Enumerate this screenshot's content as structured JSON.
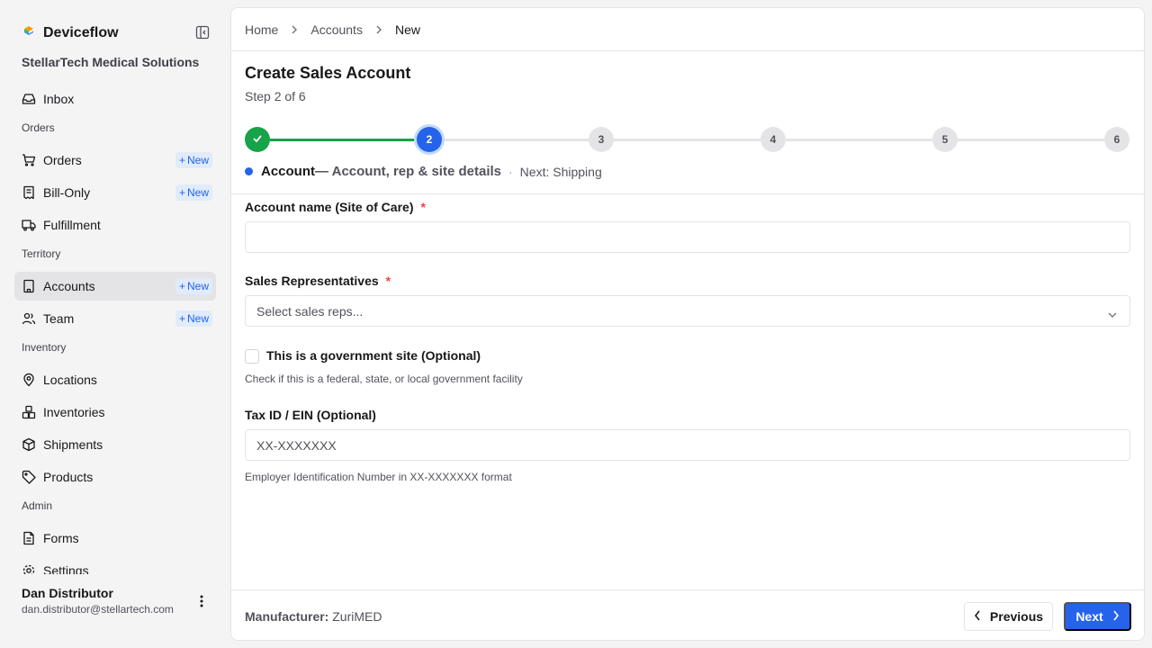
{
  "app": {
    "name": "Deviceflow",
    "org": "StellarTech Medical Solutions"
  },
  "sidebar": {
    "new_label": "New",
    "inbox": "Inbox",
    "sections": {
      "orders": "Orders",
      "territory": "Territory",
      "inventory": "Inventory",
      "admin": "Admin"
    },
    "items": {
      "orders": "Orders",
      "bill_only": "Bill-Only",
      "fulfillment": "Fulfillment",
      "accounts": "Accounts",
      "team": "Team",
      "locations": "Locations",
      "inventories": "Inventories",
      "shipments": "Shipments",
      "products": "Products",
      "forms": "Forms",
      "settings": "Settings"
    },
    "active": "accounts"
  },
  "user": {
    "name": "Dan Distributor",
    "email": "dan.distributor@stellartech.com"
  },
  "breadcrumb": {
    "home": "Home",
    "accounts": "Accounts",
    "current": "New"
  },
  "page": {
    "title": "Create Sales Account",
    "step_text": "Step 2 of 6"
  },
  "stepper": {
    "current_step": 2,
    "total_steps": 6,
    "labels": [
      "2",
      "3",
      "4",
      "5",
      "6"
    ],
    "current_name": "Account",
    "current_desc": "— Account, rep & site details",
    "separator": "·",
    "next": "Next: Shipping"
  },
  "form": {
    "account_name": {
      "label": "Account name (Site of Care)",
      "required": "*",
      "value": ""
    },
    "sales_reps": {
      "label": "Sales Representatives",
      "required": "*",
      "placeholder": "Select sales reps..."
    },
    "gov_site": {
      "label": "This is a government site (Optional)",
      "help": "Check if this is a federal, state, or local government facility",
      "checked": false
    },
    "tax_id": {
      "label": "Tax ID / EIN (Optional)",
      "placeholder": "XX-XXXXXXX",
      "help": "Employer Identification Number in XX-XXXXXXX format"
    }
  },
  "footer": {
    "manufacturer_label": "Manufacturer:",
    "manufacturer_value": "ZuriMED",
    "previous": "Previous",
    "next": "Next"
  },
  "colors": {
    "primary": "#2563eb",
    "success": "#16a34a",
    "danger": "#ef4444",
    "badge_bg": "#e0ebfb"
  }
}
